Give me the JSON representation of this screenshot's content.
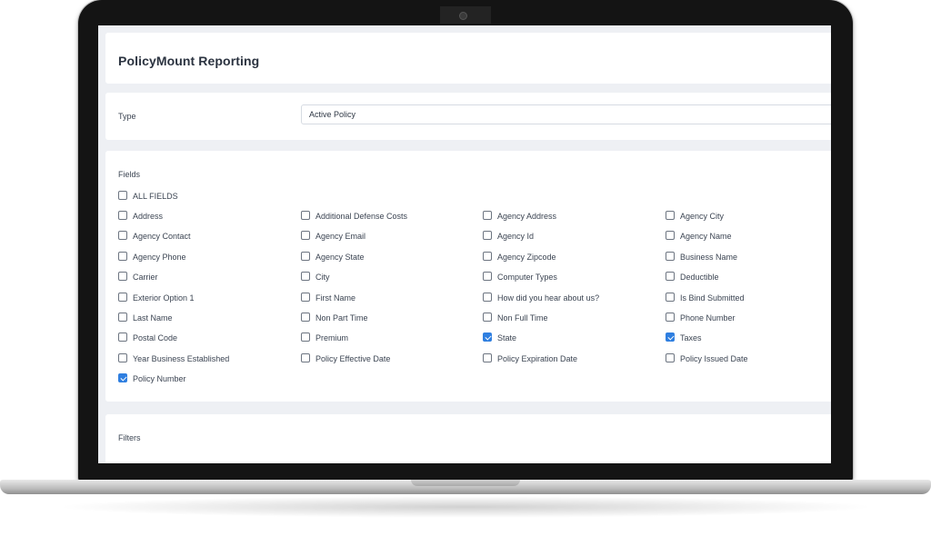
{
  "app": {
    "title": "PolicyMount Reporting",
    "type_label": "Type",
    "type_value": "Active Policy",
    "fields_label": "Fields",
    "all_fields_label": "ALL FIELDS",
    "filters_label": "Filters"
  },
  "colors": {
    "accent": "#2f7fe0",
    "page_bg": "#eef0f4",
    "text": "#3b4452"
  },
  "fields": [
    {
      "label": "Address",
      "checked": false
    },
    {
      "label": "Additional Defense Costs",
      "checked": false
    },
    {
      "label": "Agency Address",
      "checked": false
    },
    {
      "label": "Agency City",
      "checked": false
    },
    {
      "label": "Agency Contact",
      "checked": false
    },
    {
      "label": "Agency Email",
      "checked": false
    },
    {
      "label": "Agency Id",
      "checked": false
    },
    {
      "label": "Agency Name",
      "checked": false
    },
    {
      "label": "Agency Phone",
      "checked": false
    },
    {
      "label": "Agency State",
      "checked": false
    },
    {
      "label": "Agency Zipcode",
      "checked": false
    },
    {
      "label": "Business Name",
      "checked": false
    },
    {
      "label": "Carrier",
      "checked": false
    },
    {
      "label": "City",
      "checked": false
    },
    {
      "label": "Computer Types",
      "checked": false
    },
    {
      "label": "Deductible",
      "checked": false
    },
    {
      "label": "Exterior Option 1",
      "checked": false
    },
    {
      "label": "First Name",
      "checked": false
    },
    {
      "label": "How did you hear about us?",
      "checked": false
    },
    {
      "label": "Is Bind Submitted",
      "checked": false
    },
    {
      "label": "Last Name",
      "checked": false
    },
    {
      "label": "Non Part Time",
      "checked": false
    },
    {
      "label": "Non Full Time",
      "checked": false
    },
    {
      "label": "Phone Number",
      "checked": false
    },
    {
      "label": "Postal Code",
      "checked": false
    },
    {
      "label": "Premium",
      "checked": false
    },
    {
      "label": "State",
      "checked": true
    },
    {
      "label": "Taxes",
      "checked": true
    },
    {
      "label": "Year Business Established",
      "checked": false
    },
    {
      "label": "Policy Effective Date",
      "checked": false
    },
    {
      "label": "Policy Expiration Date",
      "checked": false
    },
    {
      "label": "Policy Issued Date",
      "checked": false
    },
    {
      "label": "Policy Number",
      "checked": true
    }
  ]
}
